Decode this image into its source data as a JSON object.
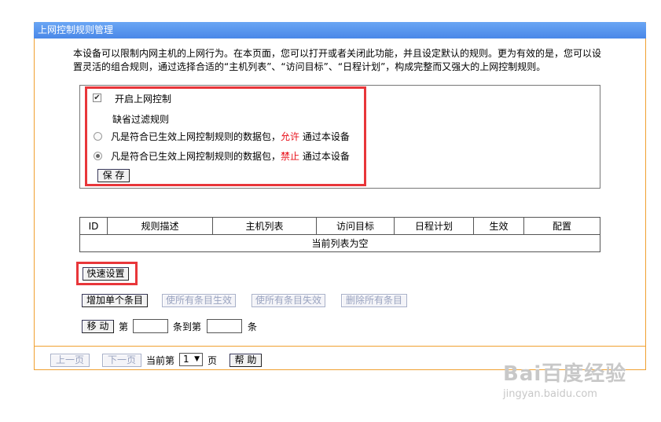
{
  "title": "上网控制规则管理",
  "description": "本设备可以限制内网主机的上网行为。在本页面，您可以打开或者关闭此功能，并且设定默认的规则。更为有效的是，您可以设置灵活的组合规则，通过选择合适的“主机列表”、“访问目标”、“日程计划”，构成完整而又强大的上网控制规则。",
  "control": {
    "enable_label": "开启上网控制",
    "enable_checked": true,
    "default_rule_label": "缺省过滤规则",
    "option_prefix": "凡是符合已生效上网控制规则的数据包，",
    "allow_word": "允许",
    "deny_word": "禁止",
    "option_suffix": "通过本设备",
    "selected": "deny",
    "save_label": "保 存"
  },
  "table": {
    "headers": [
      "ID",
      "规则描述",
      "主机列表",
      "访问目标",
      "日程计划",
      "生效",
      "配置"
    ],
    "empty_text": "当前列表为空"
  },
  "buttons": {
    "quick_setup": "快速设置",
    "add_single": "增加单个条目",
    "enable_all": "使所有条目生效",
    "disable_all": "使所有条目失效",
    "delete_all": "删除所有条目",
    "move": "移 动",
    "move_from": "第",
    "move_to": "条到第",
    "move_unit": "条"
  },
  "pagination": {
    "prev": "上一页",
    "next": "下一页",
    "current_label": "当前第",
    "current_page": "1",
    "page_unit": "页",
    "help": "帮 助"
  },
  "watermark": {
    "brand": "Bai百度经验",
    "url": "jingyan.baidu.com"
  },
  "colors": {
    "title_bar": "#4a88e8",
    "panel_border": "#f0a030",
    "highlight": "#e8363a",
    "emphasis_text": "#e8101a"
  }
}
